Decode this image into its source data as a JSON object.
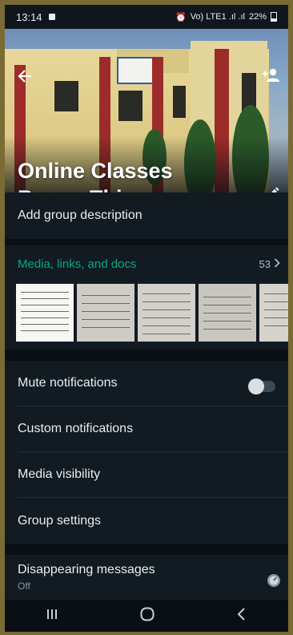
{
  "status_bar": {
    "time": "13:14",
    "signal_text": "Vo) LTE1 .ıl .ıl",
    "battery": "22%"
  },
  "header": {
    "group_name_line1": "Online Classes",
    "group_name_line2": "B.com Thir"
  },
  "description": {
    "placeholder": "Add group description"
  },
  "media": {
    "label": "Media, links, and docs",
    "count": "53",
    "thumbnails": [
      "document-photo-1",
      "document-photo-2",
      "document-photo-3",
      "document-photo-4",
      "document-photo-5"
    ]
  },
  "settings": {
    "mute": "Mute notifications",
    "custom": "Custom notifications",
    "visibility": "Media visibility",
    "group_settings": "Group settings",
    "disappearing": "Disappearing messages",
    "disappearing_value": "Off"
  },
  "colors": {
    "accent": "#00a884",
    "background": "#121b22",
    "text": "#e9edef"
  },
  "icons": [
    "back-arrow-icon",
    "add-person-icon",
    "edit-icon",
    "chevron-right-icon",
    "timer-icon",
    "recent-apps-icon",
    "home-icon",
    "back-nav-icon"
  ]
}
